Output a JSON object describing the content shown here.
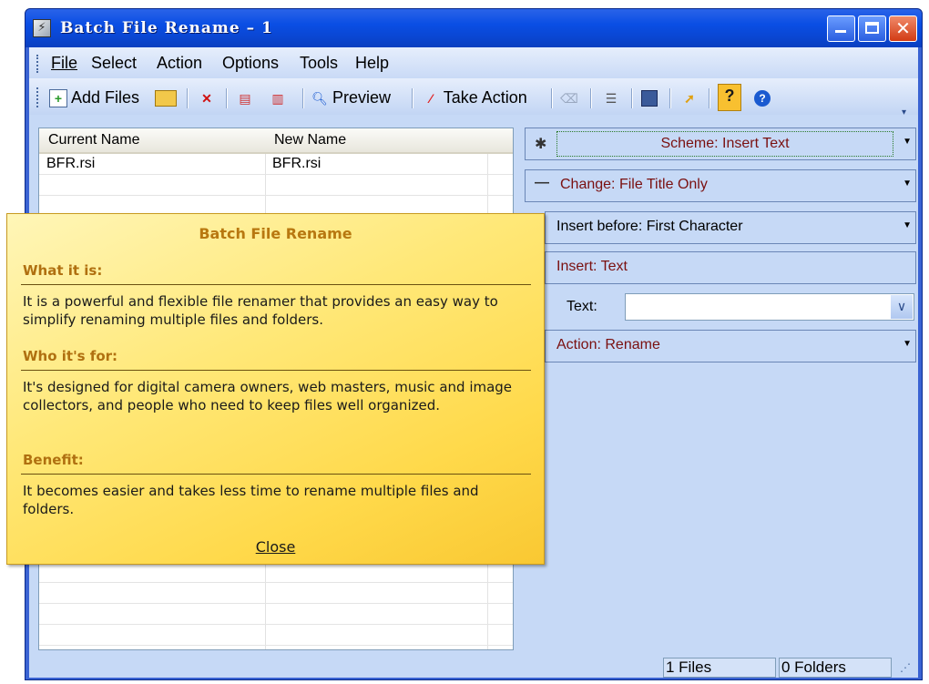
{
  "window": {
    "title": "Batch File Rename – 1"
  },
  "menu": [
    "File",
    "Select",
    "Action",
    "Options",
    "Tools",
    "Help"
  ],
  "toolbar": {
    "add_files": "Add Files",
    "preview": "Preview",
    "take_action": "Take Action"
  },
  "grid": {
    "col_current": "Current Name",
    "col_new": "New Name",
    "rows": [
      {
        "current": "BFR.rsi",
        "new": "BFR.rsi"
      }
    ]
  },
  "right_panel": {
    "scheme": "Scheme: Insert Text",
    "change": "Change: File Title Only",
    "insert_before": "Insert before: First Character",
    "insert": "Insert: Text",
    "text_label": "Text:",
    "text_value": "",
    "action": "Action: Rename"
  },
  "popup": {
    "title": "Batch File Rename",
    "h1": "What it is:",
    "p1": "It is a powerful and flexible file renamer that provides an easy way to simplify renaming multiple files and folders.",
    "h2": "Who it's for:",
    "p2": "It's designed for digital camera owners, web masters, music and image collectors, and people who need to keep files well organized.",
    "h3": "Benefit:",
    "p3": "It becomes easier and takes less time to rename multiple files and folders.",
    "close": "Close"
  },
  "status": {
    "files": "1 Files",
    "folders": "0 Folders"
  },
  "icons": [
    "app-icon",
    "minimize-icon",
    "maximize-icon",
    "close-icon",
    "add-files-icon",
    "add-folder-icon",
    "remove-icon",
    "preview-icon",
    "take-action-icon",
    "save-icon",
    "help-icon",
    "info-icon"
  ]
}
